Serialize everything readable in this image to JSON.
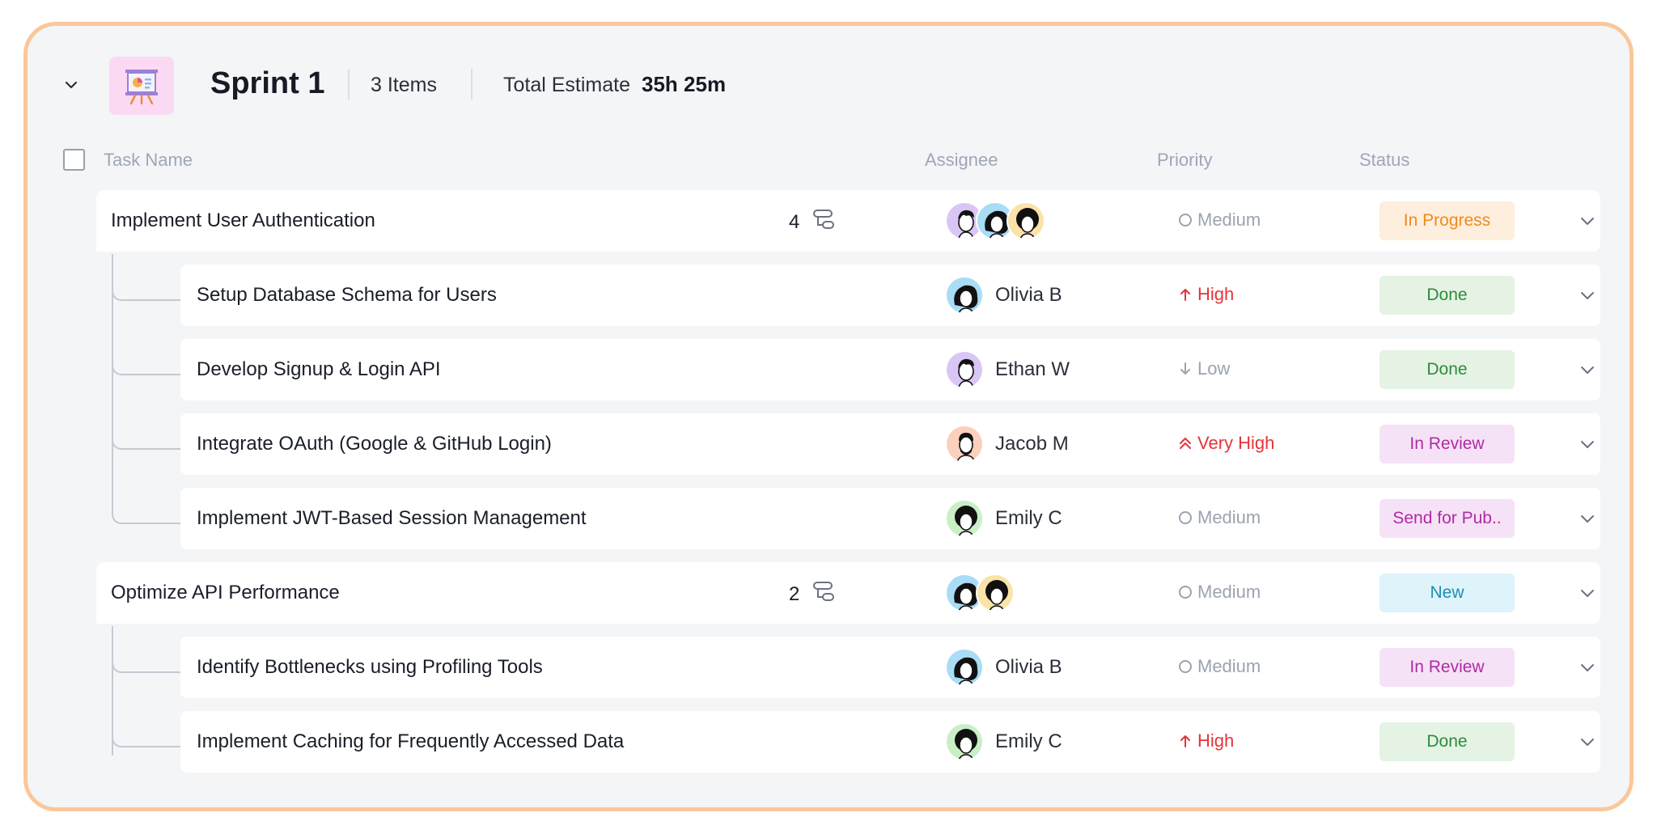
{
  "header": {
    "title": "Sprint 1",
    "items_count": "3 Items",
    "estimate_label": "Total Estimate",
    "estimate_value": "35h 25m",
    "icon": "presentation-board-icon"
  },
  "columns": {
    "task_name": "Task Name",
    "assignee": "Assignee",
    "priority": "Priority",
    "status": "Status"
  },
  "colors": {
    "frame_border": "#fbc79a",
    "medium": "#9ca3af",
    "high": "#e5343a",
    "low": "#9ca3af",
    "very_high": "#e5343a"
  },
  "tasks": [
    {
      "name": "Implement User Authentication",
      "subtask_count": "4",
      "priority": "Medium",
      "status": "In Progress",
      "subtasks": [
        {
          "name": "Setup Database Schema for Users",
          "assignee": "Olivia B",
          "priority": "High",
          "status": "Done"
        },
        {
          "name": "Develop Signup & Login API",
          "assignee": "Ethan W",
          "priority": "Low",
          "status": "Done"
        },
        {
          "name": "Integrate OAuth (Google & GitHub Login)",
          "assignee": "Jacob M",
          "priority": "Very High",
          "status": "In Review"
        },
        {
          "name": "Implement JWT-Based Session Management",
          "assignee": "Emily C",
          "priority": "Medium",
          "status": "Send for Pub.."
        }
      ]
    },
    {
      "name": "Optimize API Performance",
      "subtask_count": "2",
      "priority": "Medium",
      "status": "New",
      "subtasks": [
        {
          "name": "Identify Bottlenecks using Profiling Tools",
          "assignee": "Olivia B",
          "priority": "Medium",
          "status": "In Review"
        },
        {
          "name": "Implement Caching for Frequently Accessed Data",
          "assignee": "Emily C",
          "priority": "High",
          "status": "Done"
        }
      ]
    }
  ]
}
